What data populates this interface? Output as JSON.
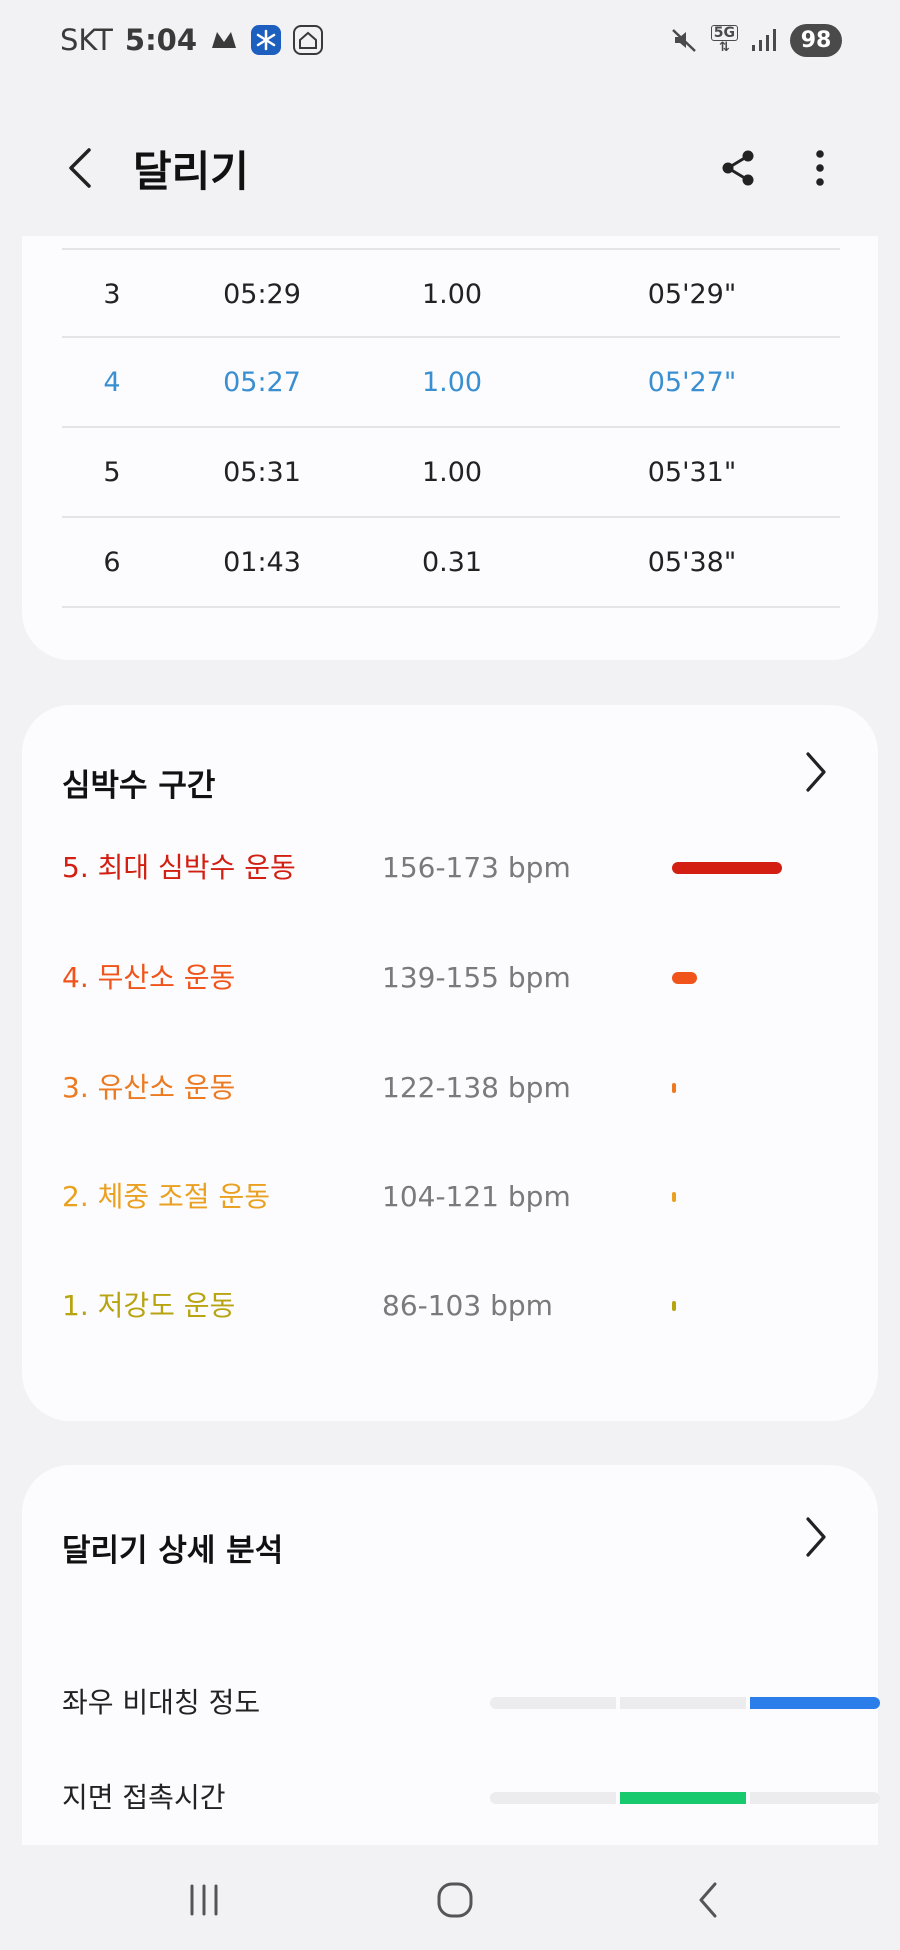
{
  "status_bar": {
    "carrier": "SKT",
    "time": "5:04",
    "network": "5G",
    "battery": "98"
  },
  "header": {
    "title": "달리기"
  },
  "splits": {
    "rows": [
      {
        "lap": "3",
        "time": "05:29",
        "distance": "1.00",
        "pace": "05'29\""
      },
      {
        "lap": "4",
        "time": "05:27",
        "distance": "1.00",
        "pace": "05'27\""
      },
      {
        "lap": "5",
        "time": "05:31",
        "distance": "1.00",
        "pace": "05'31\""
      },
      {
        "lap": "6",
        "time": "01:43",
        "distance": "0.31",
        "pace": "05'38\""
      }
    ],
    "highlight_color": "#3a8fd0"
  },
  "heart_rate": {
    "title": "심박수 구간",
    "zones": [
      {
        "label": "5. 최대 심박수 운동",
        "range": "156-173 bpm",
        "color": "#d21f12",
        "share": 0.8
      },
      {
        "label": "4. 무산소 운동",
        "range": "139-155 bpm",
        "color": "#f0541a",
        "share": 0.18
      },
      {
        "label": "3. 유산소 운동",
        "range": "122-138 bpm",
        "color": "#ec7a20",
        "share": 0.03
      },
      {
        "label": "2. 체중 조절 운동",
        "range": "104-121 bpm",
        "color": "#eaa020",
        "share": 0.02
      },
      {
        "label": "1. 저강도 운동",
        "range": "86-103 bpm",
        "color": "#b8a410",
        "share": 0.005
      }
    ]
  },
  "running_analysis": {
    "title": "달리기 상세 분석",
    "metrics": [
      {
        "label": "좌우 비대칭 정도",
        "level": 3,
        "color": "#2b7de9"
      },
      {
        "label": "지면 접촉시간",
        "level": 2,
        "color": "#19c96e"
      }
    ]
  }
}
